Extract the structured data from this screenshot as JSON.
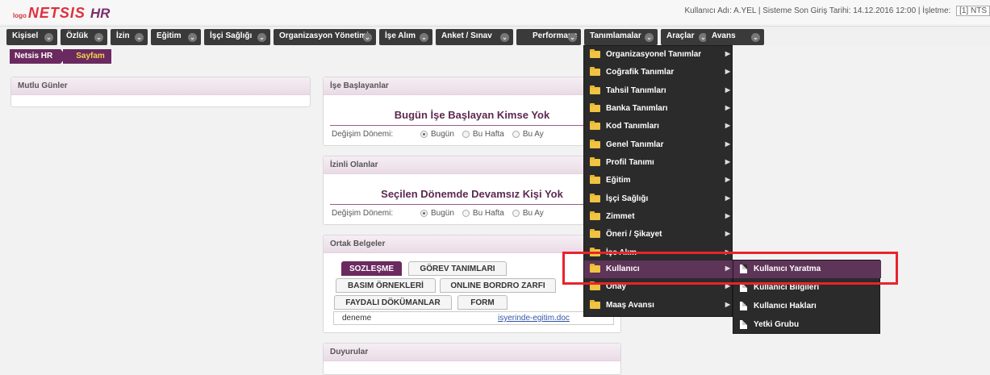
{
  "header": {
    "logo_small": "logo",
    "logo_main": "NETSIS",
    "logo_hr": "HR",
    "user_info": "Kullanıcı Adı: A.YEL | Sisteme Son Giriş Tarihi: 14.12.2016 12:00 | İşletme:",
    "firm": "[1] NTS"
  },
  "menu": [
    {
      "label": "Kişisel"
    },
    {
      "label": "Özlük"
    },
    {
      "label": "İzin"
    },
    {
      "label": "Eğitim"
    },
    {
      "label": "İşçi Sağlığı"
    },
    {
      "label": "Organizasyon Yönetimi"
    },
    {
      "label": "İşe Alım"
    },
    {
      "label": "Anket / Sınav"
    },
    {
      "label": "Performans"
    },
    {
      "label": "Tanımlamalar"
    },
    {
      "label": "Araçlar"
    },
    {
      "label": "Avans"
    }
  ],
  "breadcrumb": {
    "root": "Netsis HR",
    "current": "Sayfam"
  },
  "panels": {
    "birthdays": {
      "title": "Mutlu Günler"
    },
    "new_starters": {
      "title": "İşe Başlayanlar",
      "message": "Bugün İşe Başlayan Kimse Yok",
      "period_label": "Değişim Dönemi:",
      "options": [
        "Bugün",
        "Bu Hafta",
        "Bu Ay"
      ]
    },
    "on_leave": {
      "title": "İzinli Olanlar",
      "message": "Seçilen Dönemde Devamsız Kişi Yok",
      "period_label": "Değişim Dönemi:",
      "options": [
        "Bugün",
        "Bu Hafta",
        "Bu Ay"
      ]
    },
    "shared_docs": {
      "title": "Ortak Belgeler",
      "tabs": [
        "SOZLEŞME",
        "GÖREV TANIMLARI",
        "BASIM ÖRNEKLERİ",
        "ONLINE BORDRO ZARFI",
        "FAYDALI DÖKÜMANLAR",
        "FORM"
      ],
      "row_name": "deneme",
      "row_link": "isyerinde-egitim.doc"
    },
    "announcements": {
      "title": "Duyurular"
    }
  },
  "dropdown": [
    {
      "label": "Organizasyonel Tanımlar"
    },
    {
      "label": "Coğrafik Tanımlar"
    },
    {
      "label": "Tahsil Tanımları"
    },
    {
      "label": "Banka Tanımları"
    },
    {
      "label": "Kod Tanımları"
    },
    {
      "label": "Genel Tanımlar"
    },
    {
      "label": "Profil Tanımı"
    },
    {
      "label": "Eğitim"
    },
    {
      "label": "İşçi Sağlığı"
    },
    {
      "label": "Zimmet"
    },
    {
      "label": "Öneri / Şikayet"
    },
    {
      "label": "İşe Alım"
    },
    {
      "label": "Kullanıcı"
    },
    {
      "label": "Onay"
    },
    {
      "label": "Maaş Avansı"
    }
  ],
  "submenu": [
    {
      "label": "Kullanıcı Yaratma"
    },
    {
      "label": "Kullanıcı Bilgileri"
    },
    {
      "label": "Kullanıcı Hakları"
    },
    {
      "label": "Yetki Grubu"
    }
  ],
  "colors": {
    "accent": "#6b2a5f",
    "menu_bg": "#3a3a3a",
    "highlight": "#e8242b",
    "crumb_text": "#f6d24a"
  }
}
